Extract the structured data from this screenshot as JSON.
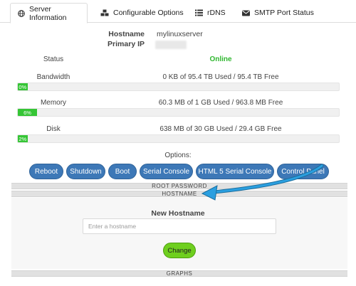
{
  "tabs": [
    {
      "label": "Server Information",
      "icon": "globe-icon"
    },
    {
      "label": "Configurable Options",
      "icon": "cubes-icon"
    },
    {
      "label": "rDNS",
      "icon": "list-icon"
    },
    {
      "label": "SMTP Port Status",
      "icon": "envelope-icon"
    }
  ],
  "info": {
    "hostname_label": "Hostname",
    "hostname_value": "mylinuxserver",
    "primary_ip_label": "Primary IP"
  },
  "status": {
    "label": "Status",
    "value": "Online",
    "color": "#2fb72f"
  },
  "usage": {
    "bandwidth": {
      "label": "Bandwidth",
      "text": "0 KB of 95.4 TB Used / 95.4 TB Free",
      "percent_label": "0%",
      "fraction": 0.0
    },
    "memory": {
      "label": "Memory",
      "text": "60.3 MB of 1 GB Used / 963.8 MB Free",
      "percent_label": "6%",
      "fraction": 0.06
    },
    "disk": {
      "label": "Disk",
      "text": "638 MB of 30 GB Used / 29.4 GB Free",
      "percent_label": "2%",
      "fraction": 0.02
    }
  },
  "options": {
    "title": "Options:",
    "buttons": [
      "Reboot",
      "Shutdown",
      "Boot",
      "Serial Console",
      "HTML 5 Serial Console",
      "Control Panel"
    ],
    "button_color": "#3d78b7"
  },
  "sections": {
    "root_password": "ROOT PASSWORD",
    "hostname": "HOSTNAME",
    "graphs": "GRAPHS"
  },
  "hostname_form": {
    "label": "New Hostname",
    "placeholder": "Enter a hostname",
    "value": "",
    "submit_label": "Change",
    "submit_color": "#6fcf1f"
  },
  "annotation": {
    "icon": "arrow-icon",
    "color": "#2a8fcf"
  }
}
